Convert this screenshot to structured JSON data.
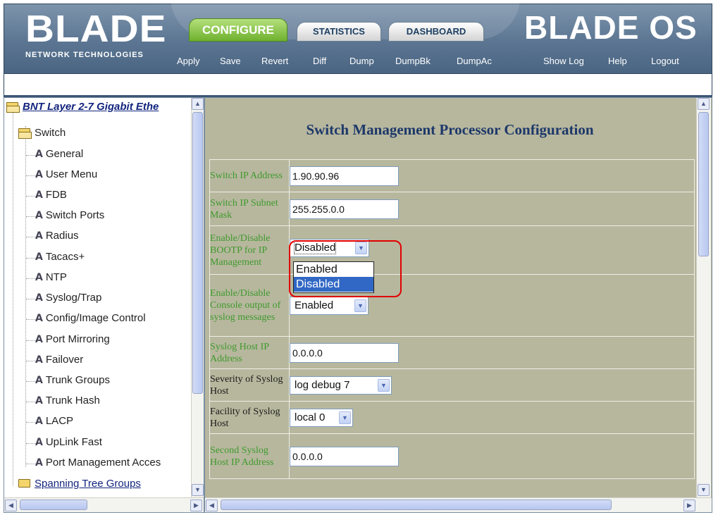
{
  "header": {
    "logo_main": "BLADE",
    "logo_sub": "NETWORK TECHNOLOGIES",
    "os_title": "BLADE OS",
    "tabs": [
      {
        "label": "CONFIGURE",
        "active": true
      },
      {
        "label": "STATISTICS",
        "active": false
      },
      {
        "label": "DASHBOARD",
        "active": false
      }
    ],
    "toolbar": [
      "Apply",
      "Save",
      "Revert",
      "Diff",
      "Dump",
      "DumpBk",
      "DumpAc"
    ],
    "right_links": [
      "Show Log",
      "Help",
      "Logout"
    ]
  },
  "tree": {
    "root": "BNT Layer 2-7 Gigabit Ethe",
    "switch_folder": "Switch",
    "items": [
      "General",
      "User Menu",
      "FDB",
      "Switch Ports",
      "Radius",
      "Tacacs+",
      "NTP",
      "Syslog/Trap",
      "Config/Image Control",
      "Port Mirroring",
      "Failover",
      "Trunk Groups",
      "Trunk Hash",
      "LACP",
      "UpLink Fast",
      "Port Management Acces"
    ],
    "next_folder": "Spanning Tree Groups"
  },
  "main": {
    "title": "Switch Management Processor Configuration",
    "rows": [
      {
        "label": "Switch IP Address",
        "value": "1.90.90.96"
      },
      {
        "label": "Switch IP Subnet Mask",
        "value": "255.255.0.0"
      },
      {
        "label": "Enable/Disable BOOTP for IP Management",
        "value": "Disabled"
      },
      {
        "label": "Enable/Disable Console output of syslog messages",
        "value": "Enabled"
      },
      {
        "label": "Syslog Host IP Address",
        "value": "0.0.0.0"
      },
      {
        "label": "Severity of Syslog Host",
        "value": "log debug 7"
      },
      {
        "label": "Facility of Syslog Host",
        "value": "local 0"
      },
      {
        "label": "Second Syslog Host IP Address",
        "value": "0.0.0.0"
      }
    ],
    "bootp_options": [
      "Enabled",
      "Disabled"
    ],
    "bootp_highlighted": "Disabled"
  },
  "colors": {
    "header_bg": "#5b7592",
    "configure_tab": "#6fb12e",
    "content_bg": "#b7b79e",
    "label_green": "#3f9a2d",
    "title_blue": "#1d3869",
    "highlight_red": "#e00000",
    "selected_option": "#3168c5"
  }
}
